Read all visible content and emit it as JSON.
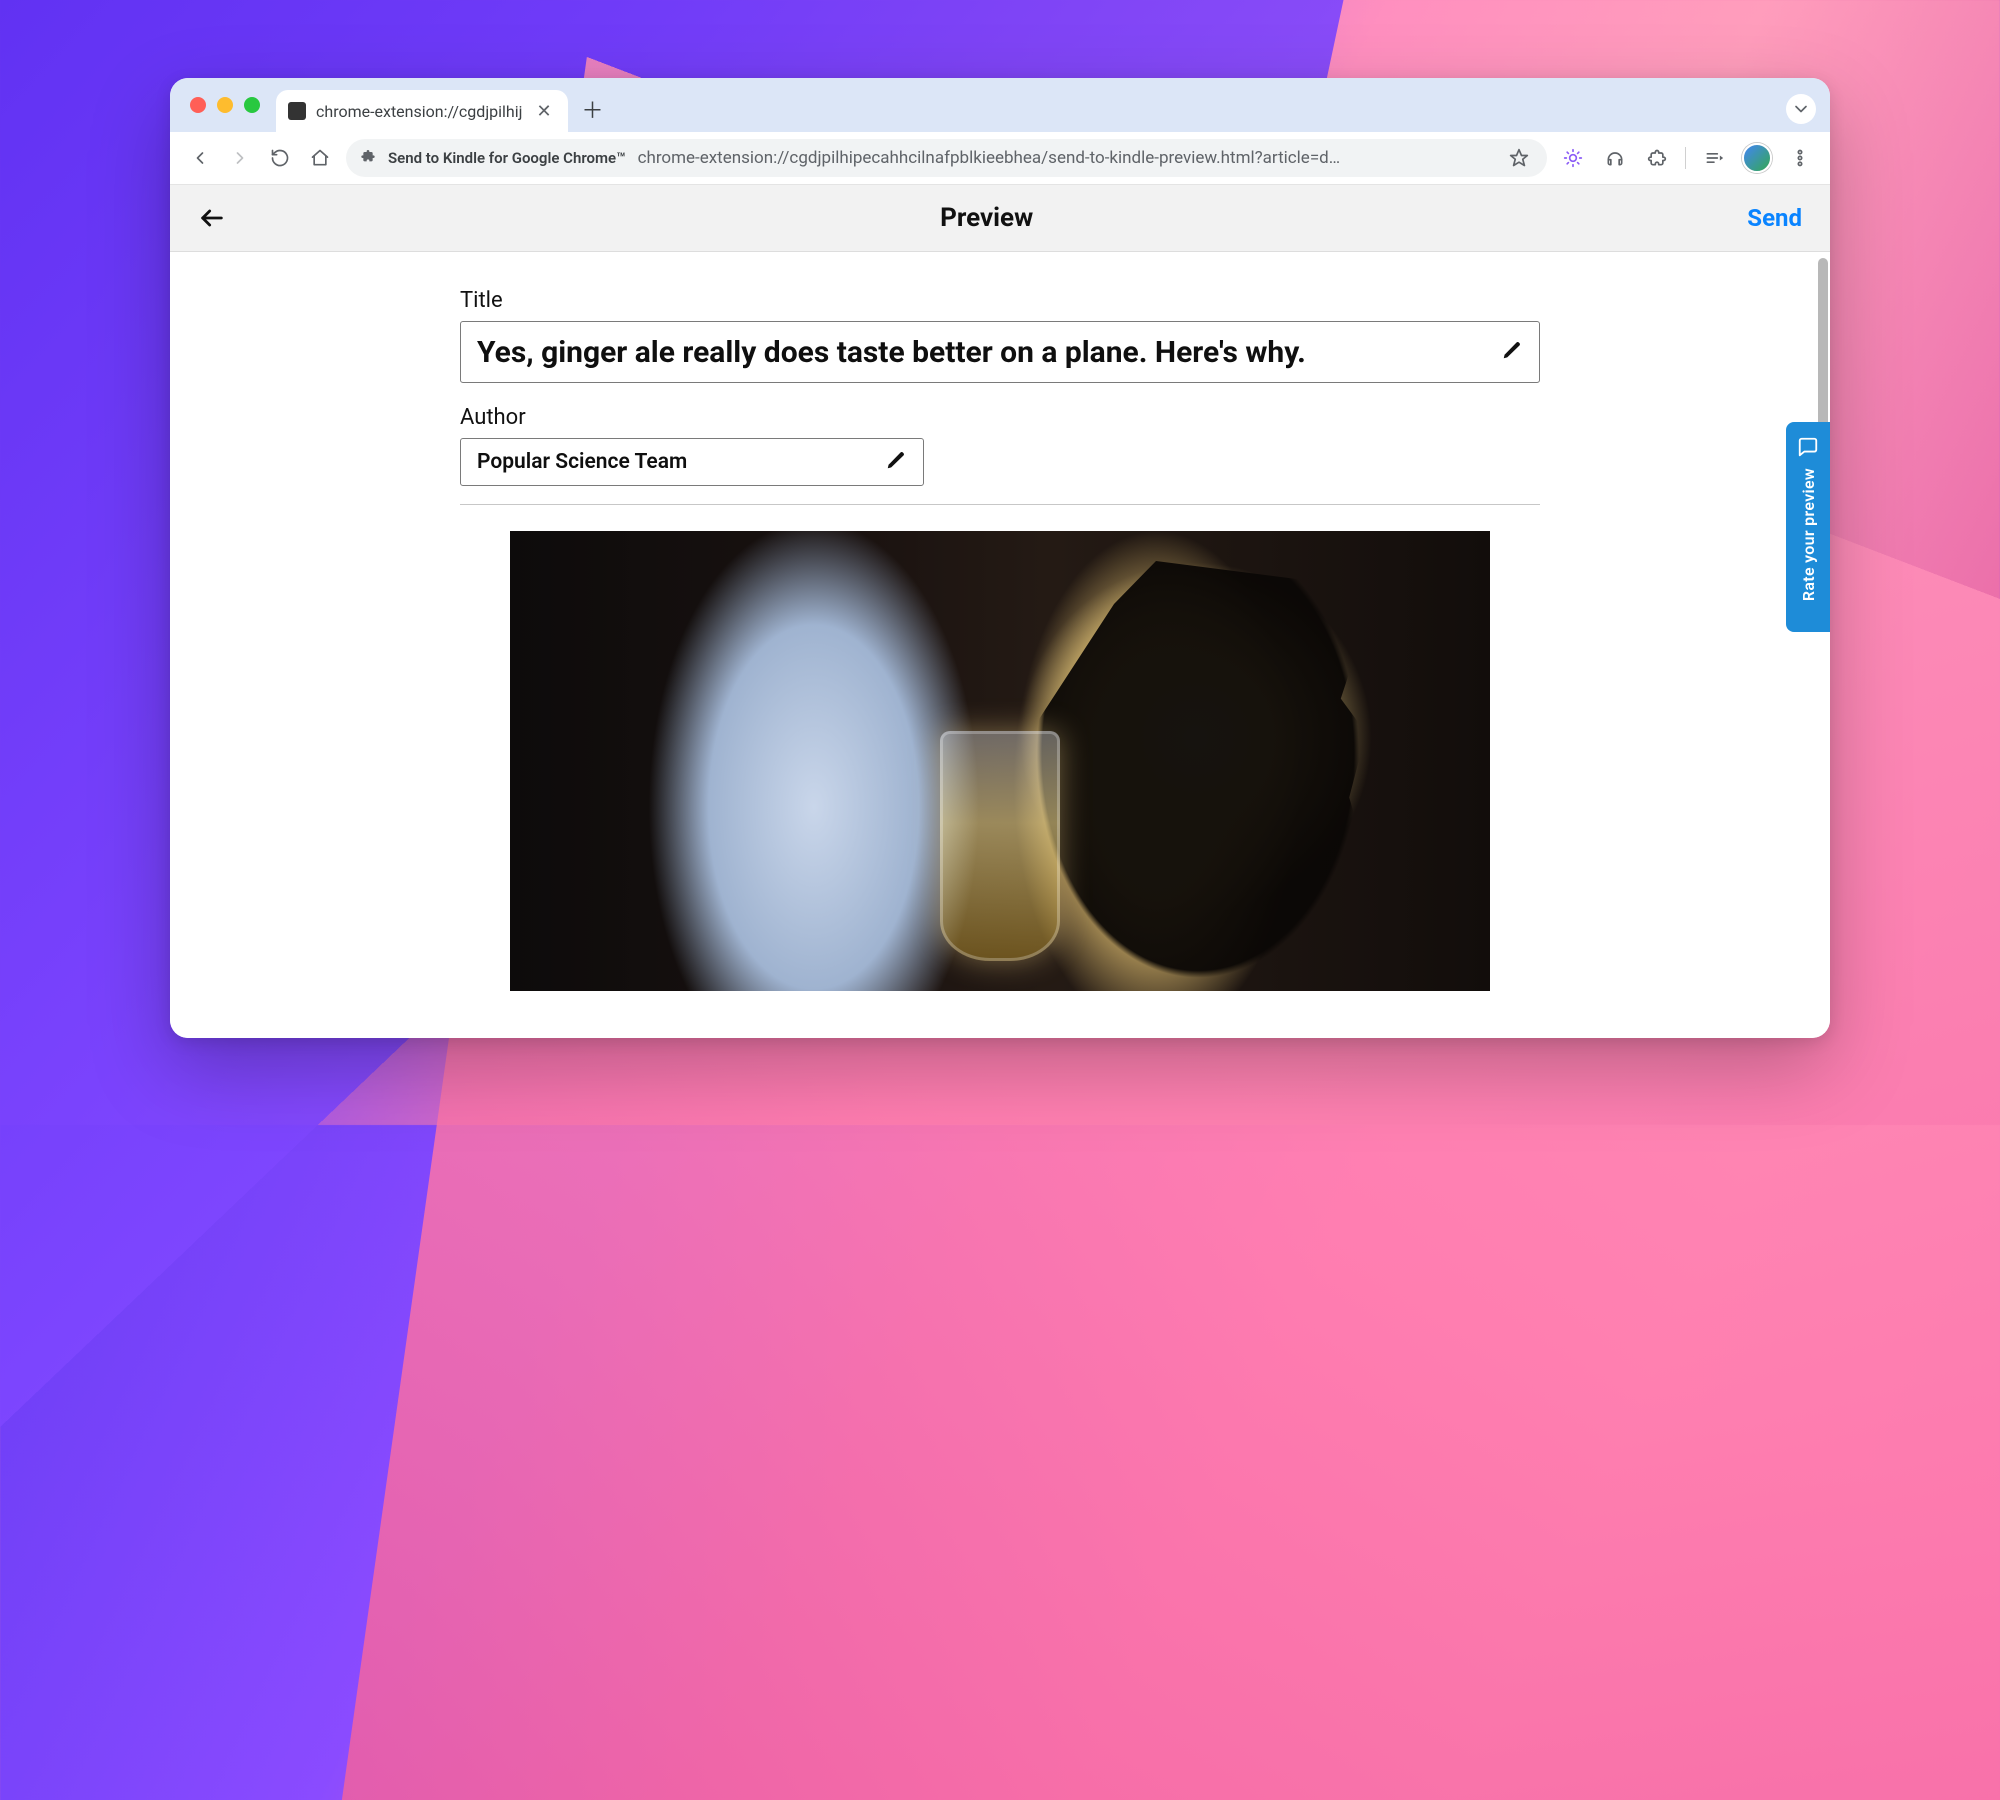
{
  "browser": {
    "tab": {
      "title": "chrome-extension://cgdjpilhij"
    },
    "omnibox": {
      "extension_name": "Send to Kindle for Google Chrome™",
      "url": "chrome-extension://cgdjpilhipecahhcilnafpblkieebhea/send-to-kindle-preview.html?article=d…"
    }
  },
  "preview": {
    "header_title": "Preview",
    "send_label": "Send",
    "title_label": "Title",
    "title_value": "Yes, ginger ale really does taste better on a plane. Here's why.",
    "author_label": "Author",
    "author_value": "Popular Science Team",
    "feedback_label": "Rate your preview"
  }
}
